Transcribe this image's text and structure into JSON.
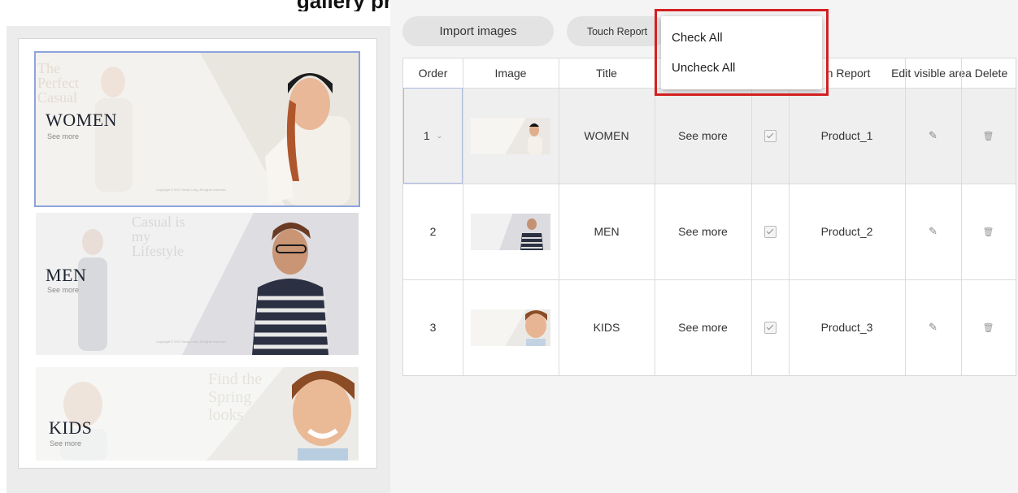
{
  "heading_text": "gallery preview    Import    Touch Report    ny image",
  "left_panel": {
    "banners": [
      {
        "title": "WOMEN",
        "subtitle": "See more",
        "ghost_text": "The Perfect Casual",
        "copyright": "Copyright © 2017 Body Long. All rights reserved."
      },
      {
        "title": "MEN",
        "subtitle": "See more",
        "ghost_text": "Casual is my Lifestyle",
        "copyright": "Copyright © 2017 Body Long. All rights reserved."
      },
      {
        "title": "KIDS",
        "subtitle": "See more",
        "ghost_text": "Find the Spring looks",
        "copyright": ""
      }
    ]
  },
  "toolbar": {
    "import_label": "Import images",
    "touch_report_label": "Touch Report"
  },
  "dropdown": {
    "items": [
      {
        "label": "Check All"
      },
      {
        "label": "Uncheck All"
      }
    ]
  },
  "table": {
    "headers": {
      "order": "Order",
      "image": "Image",
      "title": "Title",
      "touch_report": "h Report",
      "edit_area": "Edit visible area",
      "delete": "Delete"
    },
    "rows": [
      {
        "order": "1",
        "title": "WOMEN",
        "subtitle": "See more",
        "checked": true,
        "product": "Product_1"
      },
      {
        "order": "2",
        "title": "MEN",
        "subtitle": "See more",
        "checked": true,
        "product": "Product_2"
      },
      {
        "order": "3",
        "title": "KIDS",
        "subtitle": "See more",
        "checked": true,
        "product": "Product_3"
      }
    ]
  },
  "colors": {
    "selection_outline": "#8ea3dc",
    "highlight_box": "#d32022",
    "pill_bg": "#e3e3e3",
    "row_selected_bg": "#efefef"
  }
}
